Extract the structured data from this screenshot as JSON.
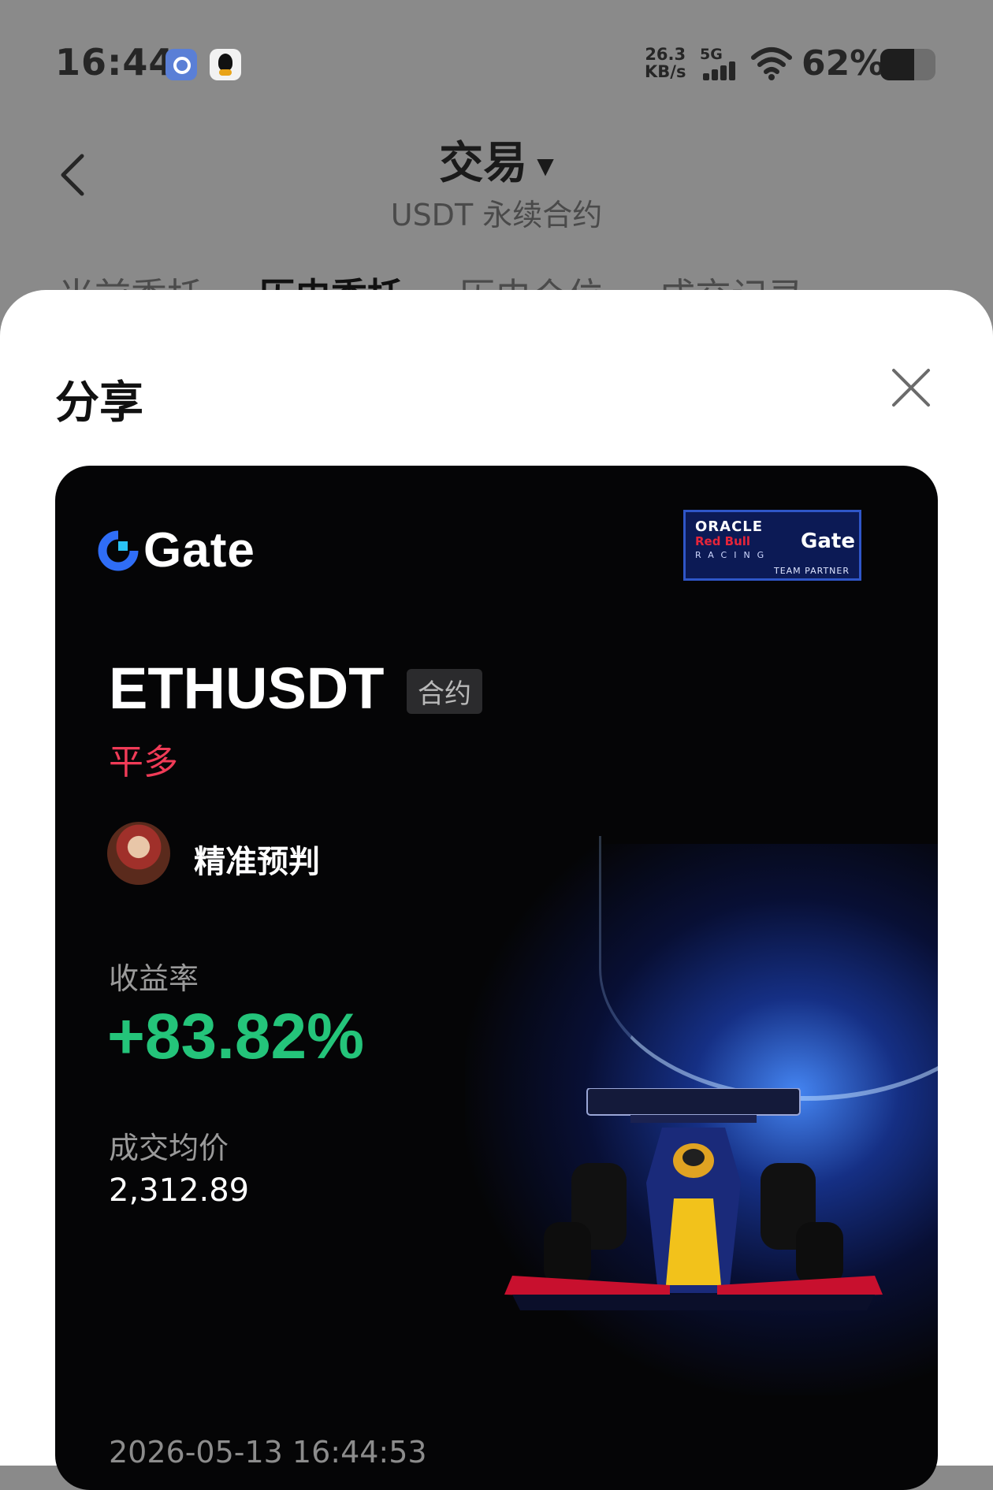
{
  "status_bar": {
    "time": "16:44",
    "net_speed_value": "26.3",
    "net_speed_unit": "KB/s",
    "network": "5G",
    "battery_percent": "62%",
    "battery_level": 0.62
  },
  "nav": {
    "title": "交易",
    "subtitle": "USDT 永续合约",
    "tabs": [
      "当前委托",
      "历史委托",
      "历史仓位",
      "成交记录"
    ],
    "active_tab": 1
  },
  "share_sheet": {
    "title": "分享"
  },
  "card": {
    "brand": "Gate",
    "partner": {
      "oracle": "ORACLE",
      "redbull": "Red Bull",
      "racing": "RACING",
      "gate": "Gate",
      "team": "TEAM PARTNER"
    },
    "symbol": "ETHUSDT",
    "tag": "合约",
    "side": "平多",
    "username": "精准预判",
    "roi_label": "收益率",
    "roi": "+83.82%",
    "price_label": "成交均价",
    "price": "2,312.89",
    "datetime": "2026-05-13 16:44:53"
  },
  "colors": {
    "profit": "#24c47a",
    "side_close_long": "#f03b57",
    "gate_blue": "#2f6df6",
    "card_bg": "#050506"
  },
  "icons": [
    "browser-app-icon",
    "qq-app-icon",
    "signal-icon",
    "wifi-icon",
    "battery-icon",
    "back-icon",
    "dropdown-caret-icon",
    "close-icon",
    "gate-logo-icon"
  ]
}
